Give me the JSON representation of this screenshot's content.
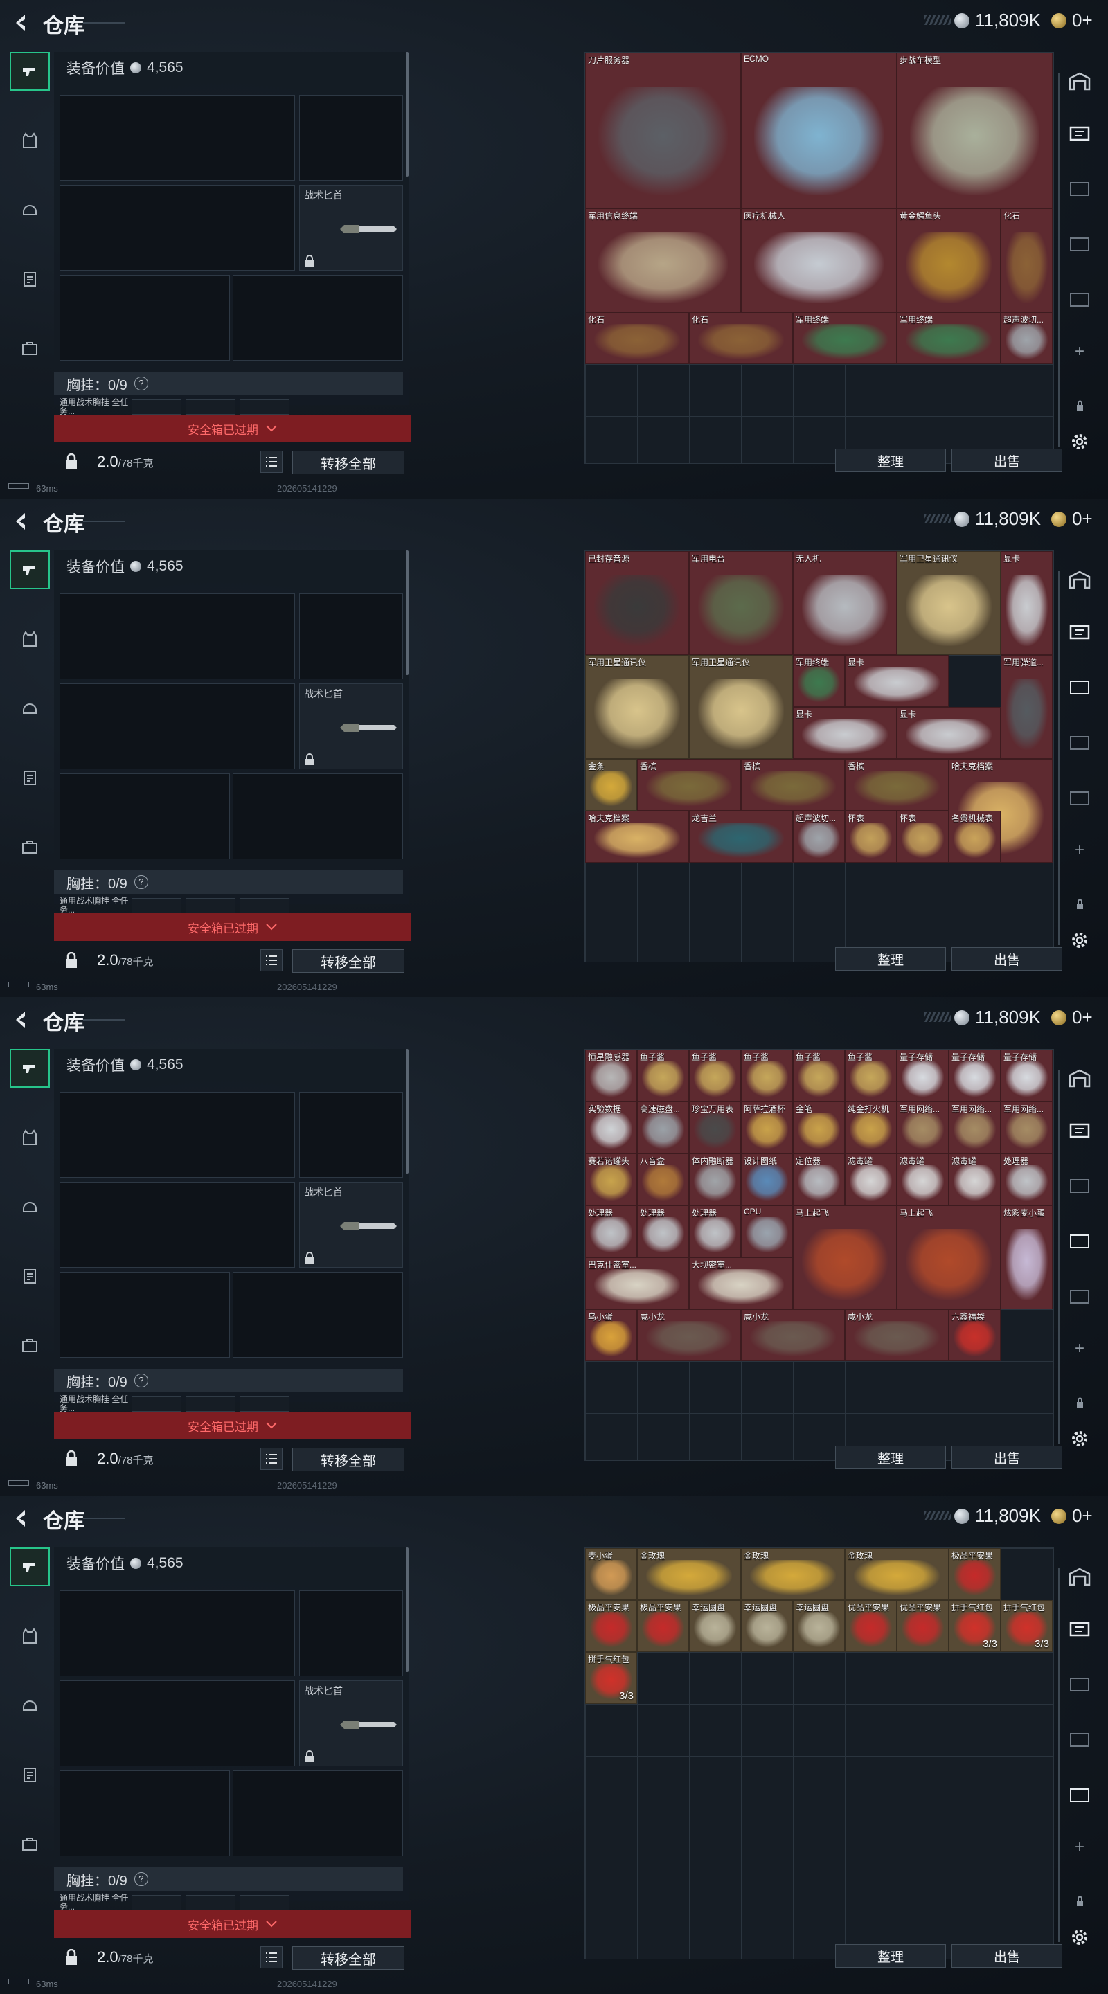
{
  "header": {
    "title": "仓库",
    "silver": "11,809K",
    "gold": "0+"
  },
  "equipment": {
    "value_label": "装备价值",
    "value": "4,565",
    "knife_label": "战术匕首",
    "rig_label": "胸挂：0/9",
    "rig_help": "?",
    "rig_sub": "通用战术胸挂 全任务..."
  },
  "safebox": {
    "expired_label": "安全箱已过期"
  },
  "footer": {
    "weight": "2.0",
    "weight_max": "/78千克",
    "transfer_all": "转移全部"
  },
  "actions": {
    "organize": "整理",
    "sell": "出售"
  },
  "status": {
    "ping": "63ms",
    "build": "202605141229"
  },
  "colors": {
    "red": "#5e2a30",
    "gold": "#574a35",
    "blue": "#2c3a4a",
    "green": "#2b4a3e",
    "empty": "#161d25"
  },
  "panels": [
    {
      "items": [
        {
          "label": "刀片服务器",
          "col": 0,
          "row": 0,
          "w": 3,
          "h": 3,
          "color": "red",
          "art": "#5c6066"
        },
        {
          "label": "ECMO",
          "col": 3,
          "row": 0,
          "w": 3,
          "h": 3,
          "color": "red",
          "art": "#7fb3d0"
        },
        {
          "label": "步战车模型",
          "col": 6,
          "row": 0,
          "w": 3,
          "h": 3,
          "color": "red",
          "art": "#a9b09b"
        },
        {
          "label": "军用信息终端",
          "col": 0,
          "row": 3,
          "w": 3,
          "h": 2,
          "color": "red",
          "art": "#b6a587"
        },
        {
          "label": "医疗机械人",
          "col": 3,
          "row": 3,
          "w": 3,
          "h": 2,
          "color": "red",
          "art": "#c5cbd2"
        },
        {
          "label": "黄金鳄鱼头",
          "col": 6,
          "row": 3,
          "w": 2,
          "h": 2,
          "color": "red",
          "art": "#b3882f"
        },
        {
          "label": "化石",
          "col": 8,
          "row": 3,
          "w": 1,
          "h": 2,
          "color": "red",
          "art": "#8b6236"
        },
        {
          "label": "化石",
          "col": 0,
          "row": 5,
          "w": 2,
          "h": 1,
          "color": "red",
          "art": "#8b6236"
        },
        {
          "label": "化石",
          "col": 2,
          "row": 5,
          "w": 2,
          "h": 1,
          "color": "red",
          "art": "#8b6236"
        },
        {
          "label": "军用终端",
          "col": 4,
          "row": 5,
          "w": 2,
          "h": 1,
          "color": "red",
          "art": "#3d7a4f"
        },
        {
          "label": "军用终端",
          "col": 6,
          "row": 5,
          "w": 2,
          "h": 1,
          "color": "red",
          "art": "#3d7a4f"
        },
        {
          "label": "超声波切...",
          "col": 8,
          "row": 5,
          "w": 1,
          "h": 1,
          "color": "red",
          "art": "#9ea4aa"
        }
      ]
    },
    {
      "items": [
        {
          "label": "已封存音源",
          "col": 0,
          "row": 0,
          "w": 2,
          "h": 2,
          "color": "red",
          "art": "#3a3a3a"
        },
        {
          "label": "军用电台",
          "col": 2,
          "row": 0,
          "w": 2,
          "h": 2,
          "color": "red",
          "art": "#5c6b4c"
        },
        {
          "label": "无人机",
          "col": 4,
          "row": 0,
          "w": 2,
          "h": 2,
          "color": "red",
          "art": "#b5babf"
        },
        {
          "label": "军用卫星通讯仪",
          "col": 6,
          "row": 0,
          "w": 2,
          "h": 2,
          "color": "gold",
          "art": "#d8c48b"
        },
        {
          "label": "显卡",
          "col": 8,
          "row": 0,
          "w": 1,
          "h": 2,
          "color": "red",
          "art": "#c9ccd0"
        },
        {
          "label": "军用卫星通讯仪",
          "col": 0,
          "row": 2,
          "w": 2,
          "h": 2,
          "color": "gold",
          "art": "#d8c48b"
        },
        {
          "label": "军用卫星通讯仪",
          "col": 2,
          "row": 2,
          "w": 2,
          "h": 2,
          "color": "gold",
          "art": "#d8c48b"
        },
        {
          "label": "军用终端",
          "col": 4,
          "row": 2,
          "w": 1,
          "h": 1,
          "color": "red",
          "art": "#3d7a4f"
        },
        {
          "label": "显卡",
          "col": 5,
          "row": 2,
          "w": 2,
          "h": 1,
          "color": "red",
          "art": "#c9ccd0"
        },
        {
          "label": "显卡",
          "col": 4,
          "row": 3,
          "w": 2,
          "h": 1,
          "color": "red",
          "art": "#c9ccd0"
        },
        {
          "label": "显卡",
          "col": 6,
          "row": 3,
          "w": 2,
          "h": 1,
          "color": "red",
          "art": "#c9ccd0"
        },
        {
          "label": "军用弹道...",
          "col": 8,
          "row": 2,
          "w": 1,
          "h": 2,
          "color": "red",
          "art": "#555b60"
        },
        {
          "label": "金条",
          "col": 0,
          "row": 4,
          "w": 1,
          "h": 1,
          "color": "gold",
          "art": "#d4a93a"
        },
        {
          "label": "香槟",
          "col": 1,
          "row": 4,
          "w": 2,
          "h": 1,
          "color": "red",
          "art": "#7a6a3a"
        },
        {
          "label": "香槟",
          "col": 3,
          "row": 4,
          "w": 2,
          "h": 1,
          "color": "red",
          "art": "#7a6a3a"
        },
        {
          "label": "香槟",
          "col": 5,
          "row": 4,
          "w": 2,
          "h": 1,
          "color": "red",
          "art": "#7a6a3a"
        },
        {
          "label": "哈夫克档案",
          "col": 7,
          "row": 4,
          "w": 2,
          "h": 2,
          "color": "red",
          "art": "#d9b265"
        },
        {
          "label": "哈夫克档案",
          "col": 0,
          "row": 5,
          "w": 2,
          "h": 1,
          "color": "red",
          "art": "#d9b265"
        },
        {
          "label": "龙吉兰",
          "col": 2,
          "row": 5,
          "w": 2,
          "h": 1,
          "color": "red",
          "art": "#2d6670"
        },
        {
          "label": "超声波切...",
          "col": 4,
          "row": 5,
          "w": 1,
          "h": 1,
          "color": "red",
          "art": "#9ea4aa"
        },
        {
          "label": "怀表",
          "col": 5,
          "row": 5,
          "w": 1,
          "h": 1,
          "color": "red",
          "art": "#c2a05a"
        },
        {
          "label": "怀表",
          "col": 6,
          "row": 5,
          "w": 1,
          "h": 1,
          "color": "red",
          "art": "#c2a05a"
        },
        {
          "label": "名贵机械表",
          "col": 7,
          "row": 5,
          "w": 1,
          "h": 1,
          "color": "red",
          "art": "#c9a35a"
        }
      ]
    },
    {
      "items": [
        {
          "label": "恒星融感器",
          "col": 0,
          "row": 0,
          "w": 1,
          "h": 1,
          "color": "red",
          "art": "#b7b7b7"
        },
        {
          "label": "鱼子酱",
          "col": 1,
          "row": 0,
          "w": 1,
          "h": 1,
          "color": "red",
          "art": "#c5a75a"
        },
        {
          "label": "鱼子酱",
          "col": 2,
          "row": 0,
          "w": 1,
          "h": 1,
          "color": "red",
          "art": "#c5a75a"
        },
        {
          "label": "鱼子酱",
          "col": 3,
          "row": 0,
          "w": 1,
          "h": 1,
          "color": "red",
          "art": "#c5a75a"
        },
        {
          "label": "鱼子酱",
          "col": 4,
          "row": 0,
          "w": 1,
          "h": 1,
          "color": "red",
          "art": "#c5a75a"
        },
        {
          "label": "鱼子酱",
          "col": 5,
          "row": 0,
          "w": 1,
          "h": 1,
          "color": "red",
          "art": "#c5a75a"
        },
        {
          "label": "量子存储",
          "col": 6,
          "row": 0,
          "w": 1,
          "h": 1,
          "color": "red",
          "art": "#d7dbe0"
        },
        {
          "label": "量子存储",
          "col": 7,
          "row": 0,
          "w": 1,
          "h": 1,
          "color": "red",
          "art": "#d7dbe0"
        },
        {
          "label": "量子存储",
          "col": 8,
          "row": 0,
          "w": 1,
          "h": 1,
          "color": "red",
          "art": "#d7dbe0"
        },
        {
          "label": "实验数据",
          "col": 0,
          "row": 1,
          "w": 1,
          "h": 1,
          "color": "red",
          "art": "#cfd3d6"
        },
        {
          "label": "高速磁盘...",
          "col": 1,
          "row": 1,
          "w": 1,
          "h": 1,
          "color": "red",
          "art": "#9aa1a7"
        },
        {
          "label": "珍宝万用表",
          "col": 2,
          "row": 1,
          "w": 1,
          "h": 1,
          "color": "red",
          "art": "#4a4a4a"
        },
        {
          "label": "阿萨拉酒杯",
          "col": 3,
          "row": 1,
          "w": 1,
          "h": 1,
          "color": "red",
          "art": "#c9a24a"
        },
        {
          "label": "金笔",
          "col": 4,
          "row": 1,
          "w": 1,
          "h": 1,
          "color": "red",
          "art": "#c9a24a"
        },
        {
          "label": "纯金打火机",
          "col": 5,
          "row": 1,
          "w": 1,
          "h": 1,
          "color": "red",
          "art": "#c9a24a"
        },
        {
          "label": "军用网络...",
          "col": 6,
          "row": 1,
          "w": 1,
          "h": 1,
          "color": "red",
          "art": "#a58c64"
        },
        {
          "label": "军用网络...",
          "col": 7,
          "row": 1,
          "w": 1,
          "h": 1,
          "color": "red",
          "art": "#a58c64"
        },
        {
          "label": "军用网络...",
          "col": 8,
          "row": 1,
          "w": 1,
          "h": 1,
          "color": "red",
          "art": "#a58c64"
        },
        {
          "label": "赛若诺罐头",
          "col": 0,
          "row": 2,
          "w": 1,
          "h": 1,
          "color": "red",
          "art": "#c7a34c"
        },
        {
          "label": "八音盒",
          "col": 1,
          "row": 2,
          "w": 1,
          "h": 1,
          "color": "red",
          "art": "#b07a3a"
        },
        {
          "label": "体内融断器",
          "col": 2,
          "row": 2,
          "w": 1,
          "h": 1,
          "color": "red",
          "art": "#a0a4a8"
        },
        {
          "label": "设计图纸",
          "col": 3,
          "row": 2,
          "w": 1,
          "h": 1,
          "color": "red",
          "art": "#5a8ab8"
        },
        {
          "label": "定位器",
          "col": 4,
          "row": 2,
          "w": 1,
          "h": 1,
          "color": "red",
          "art": "#b7bbc0"
        },
        {
          "label": "滤毒罐",
          "col": 5,
          "row": 2,
          "w": 1,
          "h": 1,
          "color": "red",
          "art": "#d5d5d5"
        },
        {
          "label": "滤毒罐",
          "col": 6,
          "row": 2,
          "w": 1,
          "h": 1,
          "color": "red",
          "art": "#d5d5d5"
        },
        {
          "label": "滤毒罐",
          "col": 7,
          "row": 2,
          "w": 1,
          "h": 1,
          "color": "red",
          "art": "#d5d5d5"
        },
        {
          "label": "处理器",
          "col": 8,
          "row": 2,
          "w": 1,
          "h": 1,
          "color": "red",
          "art": "#bfc3c7"
        },
        {
          "label": "处理器",
          "col": 0,
          "row": 3,
          "w": 1,
          "h": 1,
          "color": "red",
          "art": "#bfc3c7"
        },
        {
          "label": "处理器",
          "col": 1,
          "row": 3,
          "w": 1,
          "h": 1,
          "color": "red",
          "art": "#bfc3c7"
        },
        {
          "label": "处理器",
          "col": 2,
          "row": 3,
          "w": 1,
          "h": 1,
          "color": "red",
          "art": "#bfc3c7"
        },
        {
          "label": "CPU",
          "col": 3,
          "row": 3,
          "w": 1,
          "h": 1,
          "color": "red",
          "art": "#9aa4ae"
        },
        {
          "label": "马上起飞",
          "col": 4,
          "row": 3,
          "w": 2,
          "h": 2,
          "color": "red",
          "art": "#b04a2a"
        },
        {
          "label": "马上起飞",
          "col": 6,
          "row": 3,
          "w": 2,
          "h": 2,
          "color": "red",
          "art": "#b04a2a"
        },
        {
          "label": "炫彩麦小蛋",
          "col": 8,
          "row": 3,
          "w": 1,
          "h": 2,
          "color": "red",
          "art": "#c6b9d5"
        },
        {
          "label": "巴克什密室...",
          "col": 0,
          "row": 4,
          "w": 2,
          "h": 1,
          "color": "red",
          "art": "#d8d3c4"
        },
        {
          "label": "大坝密室...",
          "col": 2,
          "row": 4,
          "w": 2,
          "h": 1,
          "color": "red",
          "art": "#d8d3c4"
        },
        {
          "label": "鸟小蛋",
          "col": 0,
          "row": 5,
          "w": 1,
          "h": 1,
          "color": "red",
          "art": "#d9a23a"
        },
        {
          "label": "咸小龙",
          "col": 1,
          "row": 5,
          "w": 2,
          "h": 1,
          "color": "red",
          "art": "#6a5a50"
        },
        {
          "label": "咸小龙",
          "col": 3,
          "row": 5,
          "w": 2,
          "h": 1,
          "color": "red",
          "art": "#6a5a50"
        },
        {
          "label": "咸小龙",
          "col": 5,
          "row": 5,
          "w": 2,
          "h": 1,
          "color": "red",
          "art": "#6a5a50"
        },
        {
          "label": "六鑫福袋",
          "col": 7,
          "row": 5,
          "w": 1,
          "h": 1,
          "color": "red",
          "art": "#c7302a"
        }
      ]
    },
    {
      "items": [
        {
          "label": "麦小蛋",
          "col": 0,
          "row": 0,
          "w": 1,
          "h": 1,
          "color": "gold",
          "art": "#d19a55"
        },
        {
          "label": "金玫瑰",
          "col": 1,
          "row": 0,
          "w": 2,
          "h": 1,
          "color": "gold",
          "art": "#d4a93a"
        },
        {
          "label": "金玫瑰",
          "col": 3,
          "row": 0,
          "w": 2,
          "h": 1,
          "color": "gold",
          "art": "#d4a93a"
        },
        {
          "label": "金玫瑰",
          "col": 5,
          "row": 0,
          "w": 2,
          "h": 1,
          "color": "gold",
          "art": "#d4a93a"
        },
        {
          "label": "极品平安果",
          "col": 7,
          "row": 0,
          "w": 1,
          "h": 1,
          "color": "gold",
          "art": "#c52a2a"
        },
        {
          "label": "极品平安果",
          "col": 0,
          "row": 1,
          "w": 1,
          "h": 1,
          "color": "gold",
          "art": "#c52a2a"
        },
        {
          "label": "极品平安果",
          "col": 1,
          "row": 1,
          "w": 1,
          "h": 1,
          "color": "gold",
          "art": "#c52a2a"
        },
        {
          "label": "幸运圆盘",
          "col": 2,
          "row": 1,
          "w": 1,
          "h": 1,
          "color": "gold",
          "art": "#b9b39a"
        },
        {
          "label": "幸运圆盘",
          "col": 3,
          "row": 1,
          "w": 1,
          "h": 1,
          "color": "gold",
          "art": "#b9b39a"
        },
        {
          "label": "幸运圆盘",
          "col": 4,
          "row": 1,
          "w": 1,
          "h": 1,
          "color": "gold",
          "art": "#b9b39a"
        },
        {
          "label": "优品平安果",
          "col": 5,
          "row": 1,
          "w": 1,
          "h": 1,
          "color": "gold",
          "art": "#c52a2a"
        },
        {
          "label": "优品平安果",
          "col": 6,
          "row": 1,
          "w": 1,
          "h": 1,
          "color": "gold",
          "art": "#c52a2a"
        },
        {
          "label": "拼手气红包",
          "col": 7,
          "row": 1,
          "w": 1,
          "h": 1,
          "color": "gold",
          "art": "#d0312a",
          "count": "3/3"
        },
        {
          "label": "拼手气红包",
          "col": 8,
          "row": 1,
          "w": 1,
          "h": 1,
          "color": "gold",
          "art": "#d0312a",
          "count": "3/3"
        },
        {
          "label": "拼手气红包",
          "col": 0,
          "row": 2,
          "w": 1,
          "h": 1,
          "color": "gold",
          "art": "#d0312a",
          "count": "3/3"
        }
      ]
    }
  ]
}
